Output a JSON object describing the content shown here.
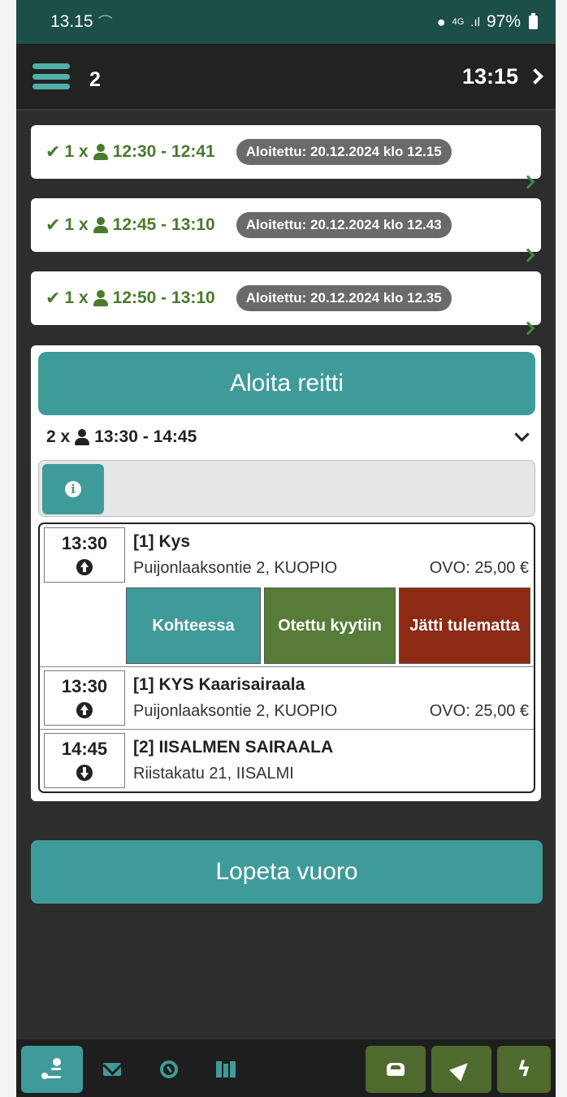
{
  "status_bar": {
    "time": "13.15",
    "network": "4G",
    "battery": "97%"
  },
  "header": {
    "count": "2",
    "clock": "13:15"
  },
  "trips": [
    {
      "passengers": "1 x",
      "time_range": "12:30 - 12:41",
      "started": "Aloitettu: 20.12.2024 klo 12.15"
    },
    {
      "passengers": "1 x",
      "time_range": "12:45 - 13:10",
      "started": "Aloitettu: 20.12.2024 klo 12.43"
    },
    {
      "passengers": "1 x",
      "time_range": "12:50 - 13:10",
      "started": "Aloitettu: 20.12.2024 klo 12.35"
    }
  ],
  "active_route": {
    "start_button": "Aloita reitti",
    "passengers": "2 x",
    "time_range": "13:30 - 14:45",
    "stops": [
      {
        "time": "13:30",
        "direction": "up",
        "name": "[1] Kys",
        "address": "Puijonlaaksontie 2, KUOPIO",
        "price": "OVO: 25,00 €"
      },
      {
        "time": "13:30",
        "direction": "up",
        "name": "[1] KYS Kaarisairaala",
        "address": "Puijonlaaksontie 2, KUOPIO",
        "price": "OVO: 25,00 €"
      },
      {
        "time": "14:45",
        "direction": "down",
        "name": "[2] IISALMEN SAIRAALA",
        "address": "Riistakatu 21, IISALMI"
      }
    ],
    "actions": {
      "arrived": "Kohteessa",
      "picked_up": "Otettu kyytiin",
      "no_show": "Jätti tulematta"
    }
  },
  "end_shift_button": "Lopeta vuoro",
  "bottom_nav": {
    "left": [
      "route-icon",
      "mail-icon",
      "dashboard-icon",
      "map-icon"
    ],
    "right": [
      "car-icon",
      "navigation-arrow-icon",
      "bolt-icon"
    ]
  },
  "colors": {
    "teal": "#3f9b9a",
    "status_green": "#1c4f47",
    "dark_green": "#567c38",
    "red": "#8c2a14",
    "text_green": "#4a7a2c"
  }
}
